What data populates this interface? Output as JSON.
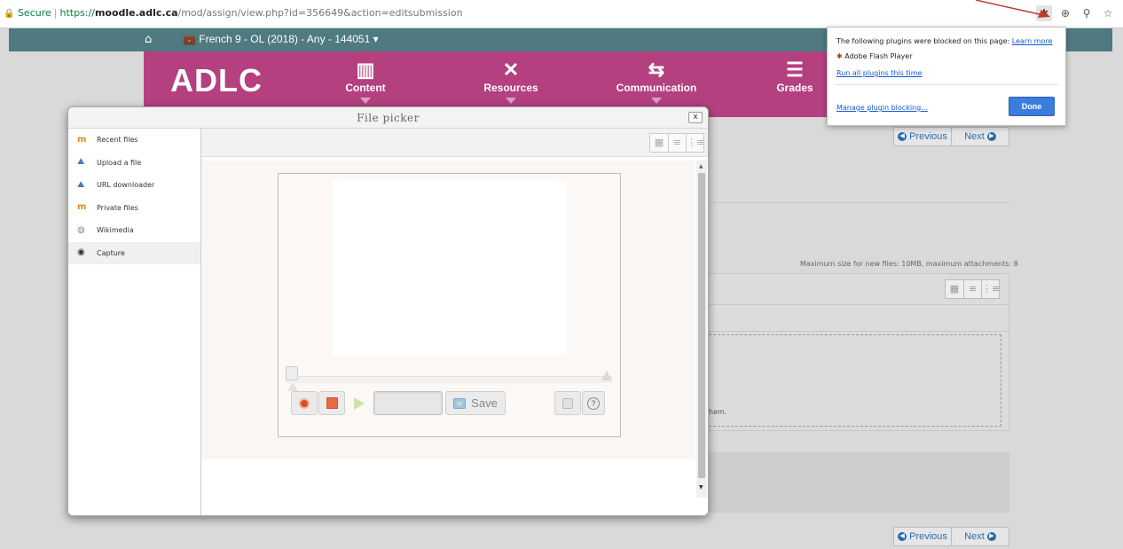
{
  "browser": {
    "secure_label": "Secure",
    "url_proto": "https://",
    "url_host": "moodle.adlc.ca",
    "url_path": "/mod/assign/view.php?id=356649&action=editsubmission",
    "icons": [
      "blocked-plugin-icon",
      "zoom-icon",
      "key-icon",
      "bookmark-star-icon"
    ]
  },
  "topnav": {
    "course": "French 9 - OL (2018) - Any - 144051 ▾"
  },
  "header": {
    "logo": "ADLC",
    "nav": [
      {
        "label": "Content"
      },
      {
        "label": "Resources"
      },
      {
        "label": "Communication"
      },
      {
        "label": "Grades"
      }
    ]
  },
  "page": {
    "previous": "Previous",
    "next": "Next",
    "max_size_text": "Maximum size for new files: 10MB, maximum attachments: 8",
    "drop_text_fragment": "hem."
  },
  "plugin_popup": {
    "message": "The following plugins were blocked on this page:",
    "learn_more": "Learn more",
    "plugin_name": "Adobe Flash Player",
    "run_all": "Run all plugins this time",
    "manage": "Manage plugin blocking...",
    "done": "Done"
  },
  "file_picker": {
    "title": "File picker",
    "close": "x",
    "sidebar": [
      {
        "label": "Recent files",
        "icon": "moodle-icon"
      },
      {
        "label": "Upload a file",
        "icon": "upload-icon"
      },
      {
        "label": "URL downloader",
        "icon": "url-icon"
      },
      {
        "label": "Private files",
        "icon": "moodle-icon"
      },
      {
        "label": "Wikimedia",
        "icon": "wikimedia-icon"
      },
      {
        "label": "Capture",
        "icon": "webcam-icon"
      }
    ],
    "selected": "Capture",
    "capture": {
      "save_label": "Save",
      "help": "?"
    }
  },
  "colors": {
    "teal_nav": "#4e7a80",
    "magenta_header": "#b4407f",
    "link_blue": "#1558d6",
    "done_blue": "#3b7ddd"
  }
}
